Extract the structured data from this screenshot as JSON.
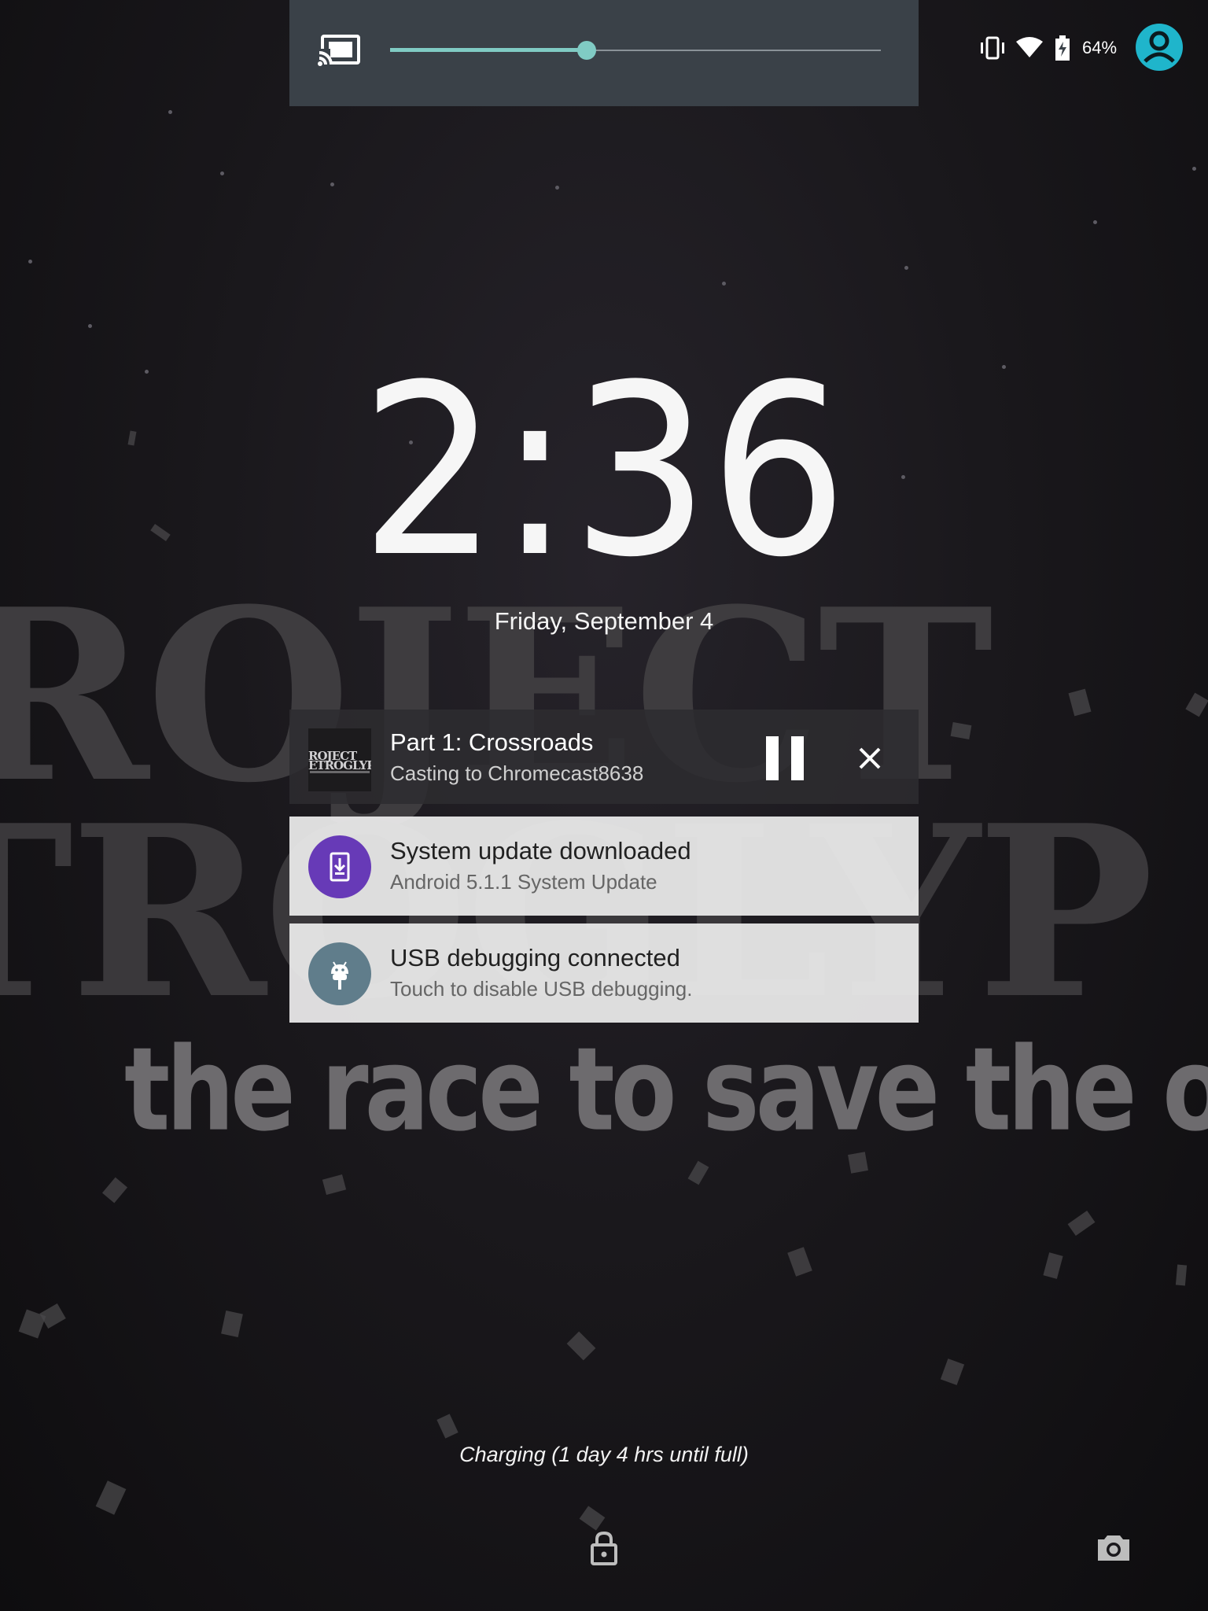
{
  "quick_settings": {
    "cast_icon": "cast-icon",
    "volume_level": 0.4,
    "status": {
      "icons": [
        "vibrate-icon",
        "wifi-icon",
        "battery-charging-icon"
      ],
      "battery_percent": "64%"
    },
    "user_icon": "user-avatar-icon",
    "accent_color": "#80cbc4"
  },
  "lockscreen": {
    "time": "2:36",
    "date": "Friday, September 4",
    "charging_text": "Charging (1 day 4 hrs until full)",
    "unlock_icon": "lock-icon",
    "camera_icon": "camera-icon"
  },
  "notifications": {
    "media": {
      "title": "Part 1: Crossroads",
      "subtitle": "Casting to Chromecast8638",
      "art_text_line1": "ROJECT",
      "art_text_line2": "ETROGLYPH",
      "pause_icon": "pause-icon",
      "close_icon": "close-icon"
    },
    "system_update": {
      "title": "System update downloaded",
      "subtitle": "Android 5.1.1 System Update",
      "icon": "system-update-icon",
      "icon_color": "#673ab7"
    },
    "usb_debugging": {
      "title": "USB debugging connected",
      "subtitle": "Touch to disable USB debugging.",
      "icon": "android-debug-icon",
      "icon_color": "#607d8b"
    }
  },
  "wallpaper": {
    "title_line1": "ROJECT",
    "title_line2": "TROGLYP",
    "tagline": "the race to save the original art"
  }
}
